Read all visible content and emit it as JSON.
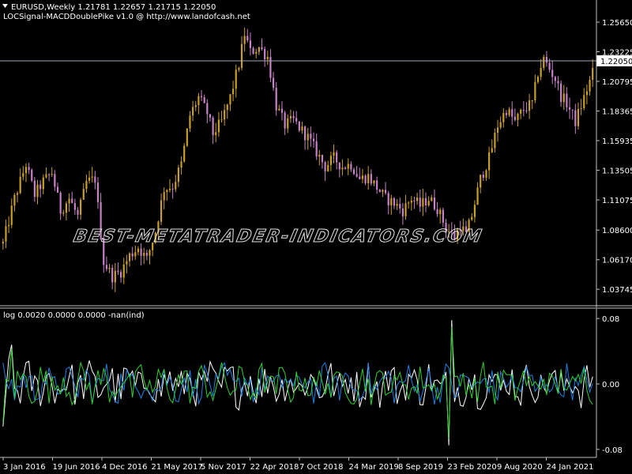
{
  "header": {
    "symbol_line": "EURUSD,Weekly  1.21781 1.22657 1.21715 1.22050",
    "indicator_line": "LOCSignal-MACDDoublePike v1.0 @ http://www.landofcash.net",
    "indicator_values": "log 0.0020 0.0000 0.0000 -nan(ind)"
  },
  "watermark": "BEST-METATRADER-INDICATORS.COM",
  "colors": {
    "background": "#000000",
    "axis": "#c0c0c0",
    "bull_candle": "#c8a028",
    "bear_candle": "#c882c8",
    "price_line": "#a0a8b8",
    "osc_main": "#ffffff",
    "osc_signal": "#2080e0",
    "osc_hist": "#30d030"
  },
  "chart_data": [
    {
      "type": "candlestick",
      "title": "EURUSD,Weekly",
      "ylim": [
        1.0272,
        1.2695
      ],
      "y_ticks": [
        "1.25650",
        "1.23225",
        "1.20795",
        "1.18365",
        "1.15935",
        "1.13505",
        "1.11075",
        "1.08600",
        "1.06170",
        "1.03745"
      ],
      "current_price": 1.2205,
      "current_price_label": "1.22050",
      "close_path": [
        [
          0,
          1.075
        ],
        [
          4,
          1.112
        ],
        [
          8,
          1.14
        ],
        [
          11,
          1.115
        ],
        [
          14,
          1.126
        ],
        [
          17,
          1.133
        ],
        [
          20,
          1.102
        ],
        [
          23,
          1.112
        ],
        [
          26,
          1.097
        ],
        [
          29,
          1.125
        ],
        [
          32,
          1.128
        ],
        [
          35,
          1.06
        ],
        [
          38,
          1.048
        ],
        [
          41,
          1.052
        ],
        [
          44,
          1.065
        ],
        [
          47,
          1.072
        ],
        [
          50,
          1.062
        ],
        [
          53,
          1.085
        ],
        [
          56,
          1.12
        ],
        [
          59,
          1.122
        ],
        [
          62,
          1.14
        ],
        [
          65,
          1.18
        ],
        [
          68,
          1.195
        ],
        [
          71,
          1.182
        ],
        [
          73,
          1.165
        ],
        [
          76,
          1.175
        ],
        [
          79,
          1.195
        ],
        [
          82,
          1.222
        ],
        [
          84,
          1.247
        ],
        [
          86,
          1.232
        ],
        [
          89,
          1.236
        ],
        [
          92,
          1.228
        ],
        [
          95,
          1.188
        ],
        [
          98,
          1.172
        ],
        [
          101,
          1.176
        ],
        [
          103,
          1.17
        ],
        [
          106,
          1.162
        ],
        [
          109,
          1.15
        ],
        [
          112,
          1.138
        ],
        [
          115,
          1.145
        ],
        [
          118,
          1.138
        ],
        [
          121,
          1.14
        ],
        [
          124,
          1.128
        ],
        [
          127,
          1.13
        ],
        [
          130,
          1.121
        ],
        [
          133,
          1.112
        ],
        [
          136,
          1.108
        ],
        [
          139,
          1.102
        ],
        [
          142,
          1.112
        ],
        [
          145,
          1.106
        ],
        [
          148,
          1.112
        ],
        [
          151,
          1.104
        ],
        [
          154,
          1.088
        ],
        [
          157,
          1.08
        ],
        [
          159,
          1.09
        ],
        [
          161,
          1.082
        ],
        [
          163,
          1.098
        ],
        [
          166,
          1.128
        ],
        [
          169,
          1.145
        ],
        [
          172,
          1.172
        ],
        [
          175,
          1.185
        ],
        [
          178,
          1.175
        ],
        [
          181,
          1.185
        ],
        [
          184,
          1.19
        ],
        [
          186,
          1.215
        ],
        [
          188,
          1.226
        ],
        [
          190,
          1.218
        ],
        [
          192,
          1.21
        ],
        [
          194,
          1.196
        ],
        [
          196,
          1.19
        ],
        [
          199,
          1.175
        ],
        [
          201,
          1.188
        ],
        [
          204,
          1.208
        ],
        [
          206,
          1.222
        ]
      ],
      "n_bars": 206
    },
    {
      "type": "line",
      "title": "LOCSignal-MACDDoublePike v1.0",
      "ylim": [
        -0.085,
        0.085
      ],
      "y_ticks": [
        "0.08",
        "0.00",
        "-0.08"
      ],
      "series": [
        {
          "color_key": "osc_main"
        },
        {
          "color_key": "osc_signal"
        },
        {
          "color_key": "osc_hist"
        }
      ],
      "spikes": [
        {
          "x": 156,
          "y": 0.078
        },
        {
          "x": 155,
          "y": -0.075
        },
        {
          "x": 3,
          "y": 0.048
        },
        {
          "x": 0,
          "y": -0.052
        }
      ],
      "x_tick_labels": [
        "3 Jan 2016",
        "19 Jun 2016",
        "4 Dec 2016",
        "21 May 2017",
        "5 Nov 2017",
        "22 Apr 2018",
        "7 Oct 2018",
        "24 Mar 2019",
        "8 Sep 2019",
        "23 Feb 2020",
        "9 Aug 2020",
        "24 Jan 2021"
      ]
    }
  ]
}
